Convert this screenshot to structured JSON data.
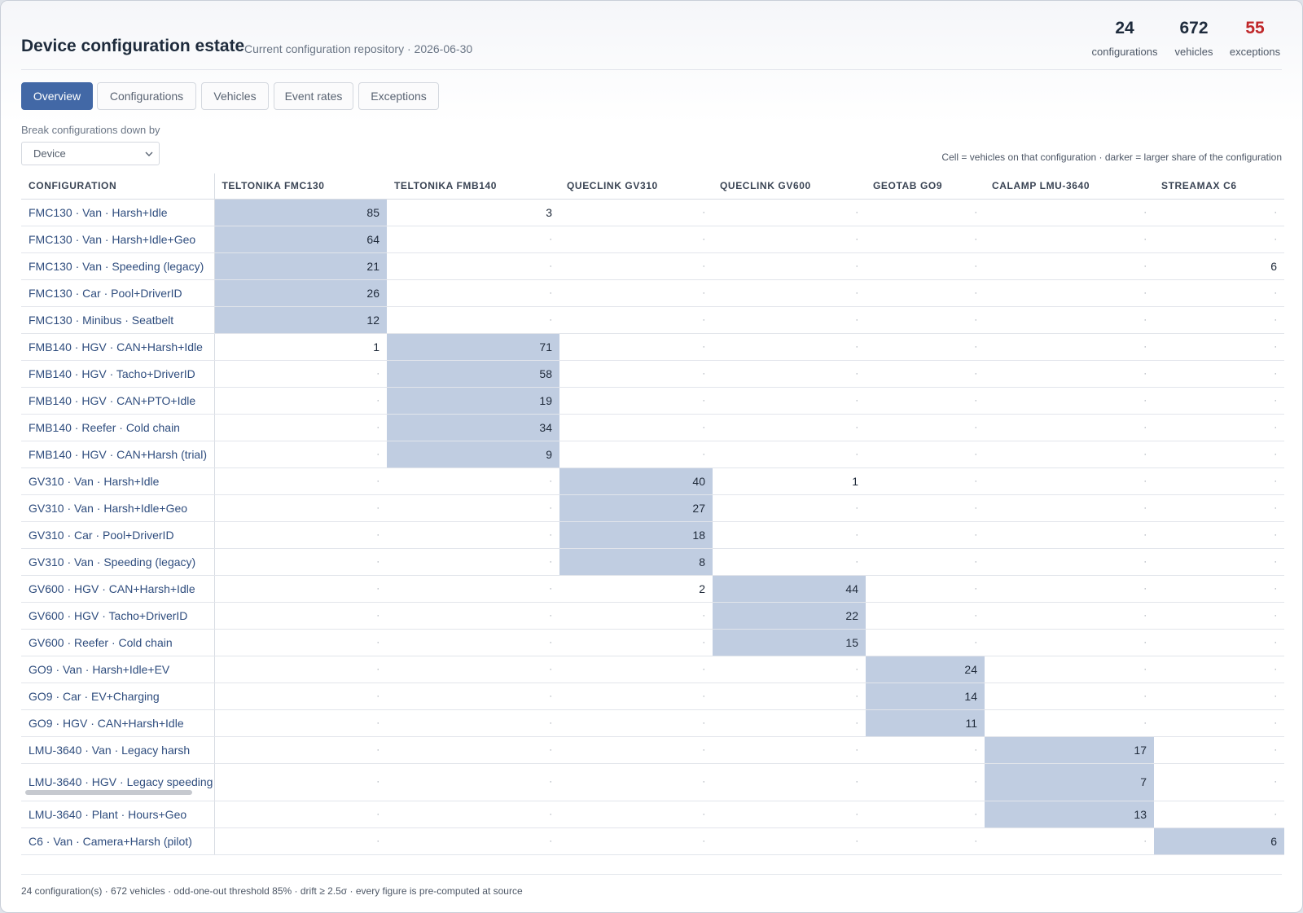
{
  "header": {
    "title": "Device configuration estate",
    "subtitle": "Current configuration repository · 2026-06-30",
    "stats": [
      {
        "value": "24",
        "label": "configurations"
      },
      {
        "value": "672",
        "label": "vehicles"
      },
      {
        "value": "55",
        "label": "exceptions",
        "color": "#c0282a"
      }
    ]
  },
  "tabs": [
    {
      "label": "Overview",
      "active": true
    },
    {
      "label": "Configurations"
    },
    {
      "label": "Vehicles"
    },
    {
      "label": "Event rates"
    },
    {
      "label": "Exceptions"
    }
  ],
  "breakdown": {
    "label": "Break configurations down by",
    "selected": "Device"
  },
  "legend_note": "Cell = vehicles on that configuration · darker = larger share of the configuration",
  "colors": {
    "accent": "#4268a6",
    "cell_highlight": "#c0cde1",
    "exception": "#c0282a"
  },
  "table": {
    "columns": [
      "CONFIGURATION",
      "TELTONIKA FMC130",
      "TELTONIKA FMB140",
      "QUECLINK GV310",
      "QUECLINK GV600",
      "GEOTAB GO9",
      "CALAMP LMU-3640",
      "STREAMAX C6"
    ],
    "empty_mark": "·",
    "rows": [
      {
        "name": "FMC130 · Van · Harsh+Idle",
        "cells": [
          "85",
          "3",
          "",
          "",
          "",
          "",
          ""
        ],
        "primary": 0
      },
      {
        "name": "FMC130 · Van · Harsh+Idle+Geo",
        "cells": [
          "64",
          "",
          "",
          "",
          "",
          "",
          ""
        ],
        "primary": 0
      },
      {
        "name": "FMC130 · Van · Speeding (legacy)",
        "cells": [
          "21",
          "",
          "",
          "",
          "",
          "",
          "6"
        ],
        "primary": 0
      },
      {
        "name": "FMC130 · Car · Pool+DriverID",
        "cells": [
          "26",
          "",
          "",
          "",
          "",
          "",
          ""
        ],
        "primary": 0
      },
      {
        "name": "FMC130 · Minibus · Seatbelt",
        "cells": [
          "12",
          "",
          "",
          "",
          "",
          "",
          ""
        ],
        "primary": 0
      },
      {
        "name": "FMB140 · HGV · CAN+Harsh+Idle",
        "cells": [
          "1",
          "71",
          "",
          "",
          "",
          "",
          ""
        ],
        "primary": 1
      },
      {
        "name": "FMB140 · HGV · Tacho+DriverID",
        "cells": [
          "",
          "58",
          "",
          "",
          "",
          "",
          ""
        ],
        "primary": 1
      },
      {
        "name": "FMB140 · HGV · CAN+PTO+Idle",
        "cells": [
          "",
          "19",
          "",
          "",
          "",
          "",
          ""
        ],
        "primary": 1
      },
      {
        "name": "FMB140 · Reefer · Cold chain",
        "cells": [
          "",
          "34",
          "",
          "",
          "",
          "",
          ""
        ],
        "primary": 1
      },
      {
        "name": "FMB140 · HGV · CAN+Harsh (trial)",
        "cells": [
          "",
          "9",
          "",
          "",
          "",
          "",
          ""
        ],
        "primary": 1
      },
      {
        "name": "GV310 · Van · Harsh+Idle",
        "cells": [
          "",
          "",
          "40",
          "1",
          "",
          "",
          ""
        ],
        "primary": 2
      },
      {
        "name": "GV310 · Van · Harsh+Idle+Geo",
        "cells": [
          "",
          "",
          "27",
          "",
          "",
          "",
          ""
        ],
        "primary": 2
      },
      {
        "name": "GV310 · Car · Pool+DriverID",
        "cells": [
          "",
          "",
          "18",
          "",
          "",
          "",
          ""
        ],
        "primary": 2
      },
      {
        "name": "GV310 · Van · Speeding (legacy)",
        "cells": [
          "",
          "",
          "8",
          "",
          "",
          "",
          ""
        ],
        "primary": 2
      },
      {
        "name": "GV600 · HGV · CAN+Harsh+Idle",
        "cells": [
          "",
          "",
          "2",
          "44",
          "",
          "",
          ""
        ],
        "primary": 3
      },
      {
        "name": "GV600 · HGV · Tacho+DriverID",
        "cells": [
          "",
          "",
          "",
          "22",
          "",
          "",
          ""
        ],
        "primary": 3
      },
      {
        "name": "GV600 · Reefer · Cold chain",
        "cells": [
          "",
          "",
          "",
          "15",
          "",
          "",
          ""
        ],
        "primary": 3
      },
      {
        "name": "GO9 · Van · Harsh+Idle+EV",
        "cells": [
          "",
          "",
          "",
          "",
          "24",
          "",
          ""
        ],
        "primary": 4
      },
      {
        "name": "GO9 · Car · EV+Charging",
        "cells": [
          "",
          "",
          "",
          "",
          "14",
          "",
          ""
        ],
        "primary": 4
      },
      {
        "name": "GO9 · HGV · CAN+Harsh+Idle",
        "cells": [
          "",
          "",
          "",
          "",
          "11",
          "",
          ""
        ],
        "primary": 4
      },
      {
        "name": "LMU-3640 · Van · Legacy harsh",
        "cells": [
          "",
          "",
          "",
          "",
          "",
          "17",
          ""
        ],
        "primary": 5
      },
      {
        "name": "LMU-3640 · HGV · Legacy speeding",
        "cells": [
          "",
          "",
          "",
          "",
          "",
          "7",
          ""
        ],
        "primary": 5,
        "tall": true
      },
      {
        "name": "LMU-3640 · Plant · Hours+Geo",
        "cells": [
          "",
          "",
          "",
          "",
          "",
          "13",
          ""
        ],
        "primary": 5
      },
      {
        "name": "C6 · Van · Camera+Harsh (pilot)",
        "cells": [
          "",
          "",
          "",
          "",
          "",
          "",
          "6"
        ],
        "primary": 6
      }
    ]
  },
  "footer": "24 configuration(s) · 672 vehicles · odd-one-out threshold 85% · drift ≥ 2.5σ · every figure is pre-computed at source"
}
